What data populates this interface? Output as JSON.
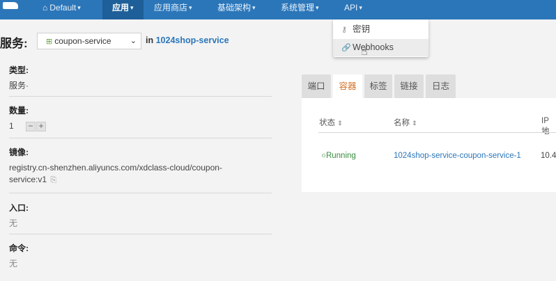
{
  "nav": {
    "env_label": "Default",
    "items": [
      "应用",
      "应用商店",
      "基础架构",
      "系统管理",
      "API"
    ]
  },
  "api_menu": {
    "items": [
      "密钥",
      "Webhooks"
    ]
  },
  "service": {
    "title": "服务:",
    "selected": "coupon-service",
    "in_label": "in",
    "stack": "1024shop-service"
  },
  "details": {
    "type_label": "类型:",
    "type_value": "服务·",
    "count_label": "数量:",
    "count_value": "1",
    "image_label": "镜像:",
    "image_value": "registry.cn-shenzhen.aliyuncs.com/xdclass-cloud/coupon-service:v1",
    "entry_label": "入口:",
    "entry_value": "无",
    "command_label": "命令:",
    "command_value": "无"
  },
  "tabs": [
    "端口",
    "容器",
    "标签",
    "链接",
    "日志"
  ],
  "table": {
    "headers": [
      "状态",
      "名称",
      "IP地"
    ],
    "rows": [
      {
        "state": "Running",
        "name": "1024shop-service-coupon-service-1",
        "ip": "10.4"
      }
    ]
  },
  "colors": {
    "nav_bg": "#2b76b9",
    "accent_tab": "#d4732a",
    "running": "#3a8c3f",
    "link": "#2b76b9"
  }
}
